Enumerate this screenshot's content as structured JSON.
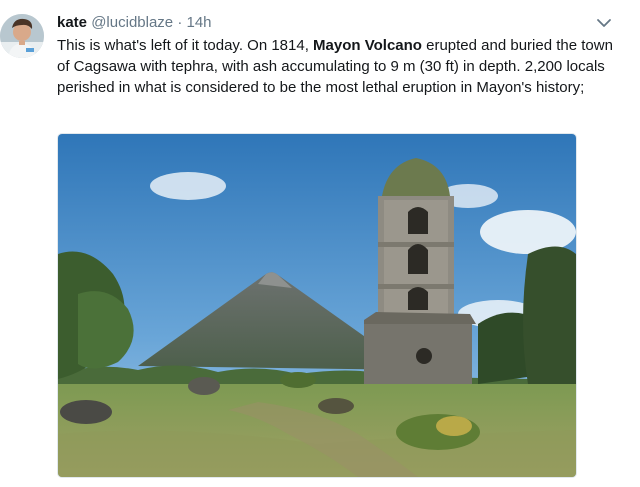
{
  "tweet": {
    "display_name": "kate",
    "handle": "@lucidblaze",
    "separator": "·",
    "time": "14h",
    "text_part1": "This is what's left of it today. On 1814, ",
    "text_bold": "Mayon Volcano",
    "text_part2": " erupted and buried the town of Cagsawa with tephra, with ash accumulating to 9 m (30 ft) in depth. 2,200 locals perished in what is considered to be the most lethal eruption in Mayon's history;"
  },
  "icons": {
    "menu": "chevron-down-icon"
  },
  "colors": {
    "text": "#14171a",
    "secondary": "#657786"
  }
}
